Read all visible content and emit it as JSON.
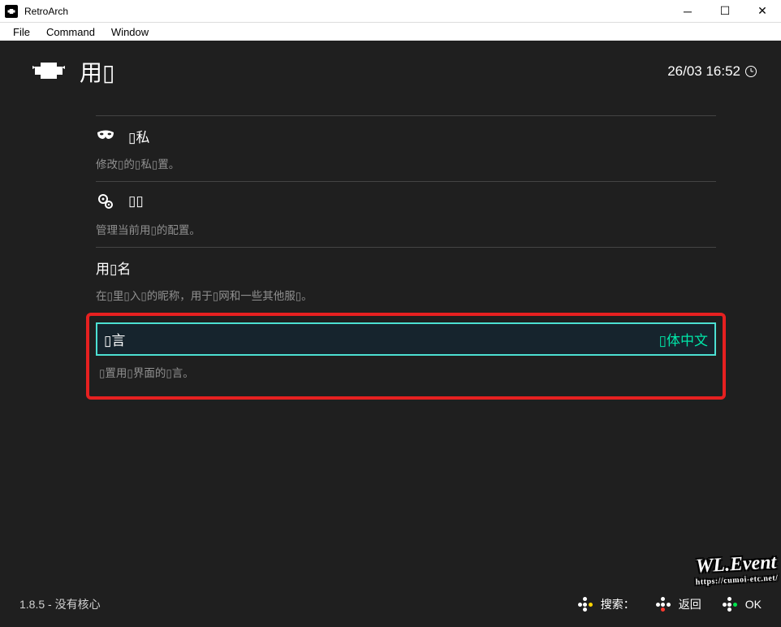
{
  "window": {
    "title": "RetroArch",
    "menu": {
      "file": "File",
      "command": "Command",
      "window": "Window"
    }
  },
  "header": {
    "title": "用▯",
    "datetime": "26/03 16:52"
  },
  "sections": [
    {
      "label": "▯私",
      "desc": "修改▯的▯私▯置。"
    },
    {
      "label": "▯▯",
      "desc": "管理当前用▯的配置。"
    },
    {
      "label": "用▯名",
      "desc": "在▯里▯入▯的昵称，用于▯网和一些其他服▯。"
    },
    {
      "label": "▯言",
      "value": "▯体中文",
      "desc": "▯置用▯界面的▯言。"
    }
  ],
  "footer": {
    "version": "1.8.5 - 没有核心",
    "search": "搜索：",
    "back": "返回",
    "ok": "OK"
  },
  "watermark": {
    "big": "WL.Event",
    "small": "https://cumoi-etc.net/"
  }
}
